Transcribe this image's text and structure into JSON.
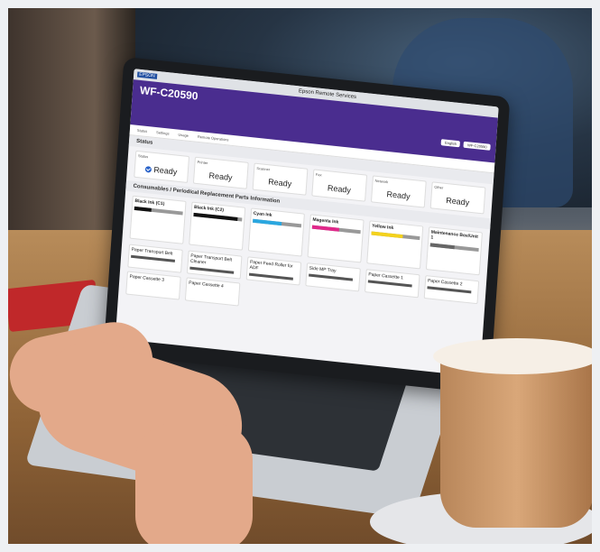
{
  "scene": {
    "description_tags": [
      "laptop",
      "hands-typing",
      "coffee-cup",
      "cafe-window",
      "red-book"
    ]
  },
  "app": {
    "brand": "EPSON",
    "title": "Epson Remote Services",
    "model": "WF-C20590",
    "nav": [
      "Status",
      "Settings",
      "Usage",
      "Remote Operations"
    ],
    "controls": [
      "English",
      "WF-C20590"
    ]
  },
  "status": {
    "section_title": "Status",
    "cards": [
      {
        "label": "Status",
        "value": "Ready"
      },
      {
        "label": "Printer",
        "value": "Ready"
      },
      {
        "label": "Scanner",
        "value": "Ready"
      },
      {
        "label": "Fax",
        "value": "Ready"
      },
      {
        "label": "Network",
        "value": "Ready"
      },
      {
        "label": "Other",
        "value": "Ready"
      }
    ]
  },
  "consumables": {
    "section_title": "Consumables / Periodical Replacement Parts Information",
    "inks": [
      {
        "name": "Black Ink (C1)",
        "color": "#111111",
        "level": 0.35
      },
      {
        "name": "Black Ink (C2)",
        "color": "#111111",
        "level": 0.9
      },
      {
        "name": "Cyan Ink",
        "color": "#2aa7e0",
        "level": 0.6
      },
      {
        "name": "Magenta Ink",
        "color": "#e0288a",
        "level": 0.55
      },
      {
        "name": "Yellow Ink",
        "color": "#f4d21c",
        "level": 0.65
      },
      {
        "name": "Maintenance Box/Unit 1",
        "color": "#666666",
        "level": 0.5
      }
    ],
    "parts": [
      {
        "name": "Paper Transport Belt"
      },
      {
        "name": "Paper Transport Belt Cleaner"
      },
      {
        "name": "Paper Feed Roller for ADF"
      },
      {
        "name": "Side MP Tray"
      },
      {
        "name": "Paper Cassette 1"
      },
      {
        "name": "Paper Cassette 2"
      }
    ],
    "extra_parts": [
      {
        "name": "Paper Cassette 3"
      },
      {
        "name": "Paper Cassette 4"
      }
    ]
  }
}
